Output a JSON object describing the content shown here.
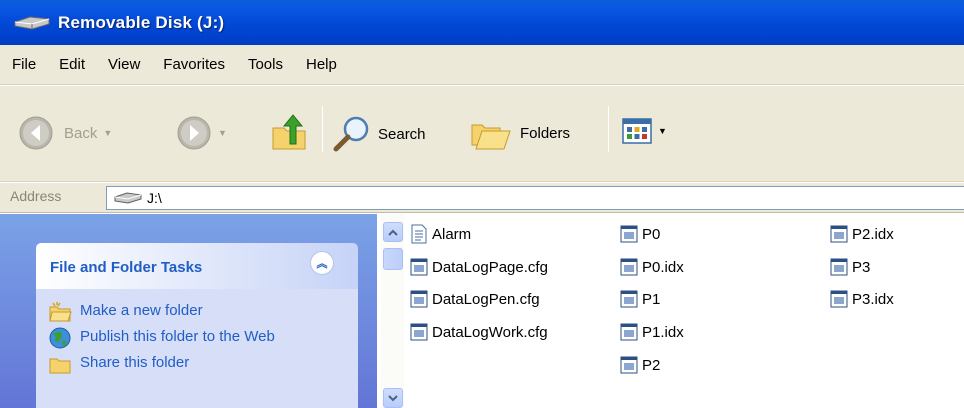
{
  "window": {
    "title": "Removable Disk (J:)"
  },
  "menu": [
    "File",
    "Edit",
    "View",
    "Favorites",
    "Tools",
    "Help"
  ],
  "toolbar": {
    "back_label": "Back",
    "search_label": "Search",
    "folders_label": "Folders",
    "icons": [
      "back-arrow-icon",
      "forward-arrow-icon",
      "up-folder-icon",
      "search-magnifier-icon",
      "folders-icon",
      "views-icon"
    ]
  },
  "address": {
    "label": "Address",
    "value": "J:\\"
  },
  "task_pane": {
    "header": "File and Folder Tasks",
    "items": [
      {
        "label": "Make a new folder",
        "icon": "new-folder-icon"
      },
      {
        "label": "Publish this folder to the Web",
        "icon": "publish-web-icon"
      },
      {
        "label": "Share this folder",
        "icon": "share-folder-icon"
      }
    ]
  },
  "files": {
    "col1": [
      "Alarm",
      "DataLogPage.cfg",
      "DataLogPen.cfg",
      "DataLogWork.cfg"
    ],
    "col2": [
      "P0",
      "P0.idx",
      "P1",
      "P1.idx",
      "P2"
    ],
    "col3": [
      "P2.idx",
      "P3",
      "P3.idx"
    ]
  },
  "colors": {
    "title_bar": "#0054e3",
    "task_link": "#215dc6",
    "chrome": "#ece9d8"
  }
}
